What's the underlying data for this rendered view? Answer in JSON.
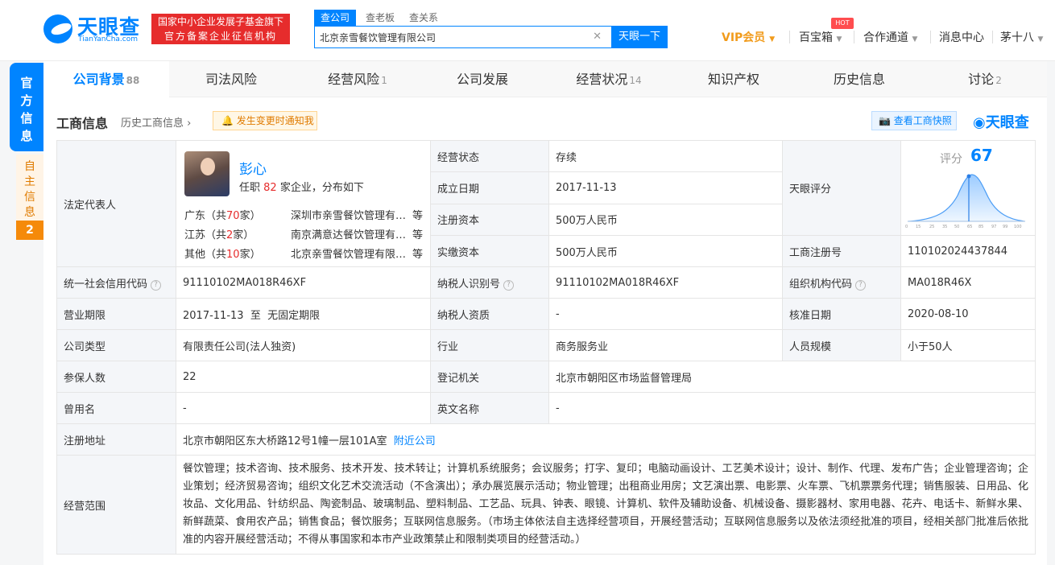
{
  "header": {
    "logo_name": "天眼查",
    "logo_domain": "TianYanCha.com",
    "promo_line1": "国家中小企业发展子基金旗下",
    "promo_line2": "官方备案企业征信机构",
    "search_tabs": [
      "查公司",
      "查老板",
      "查关系"
    ],
    "search_value": "北京亲雪餐饮管理有限公司",
    "search_button": "天眼一下",
    "nav": {
      "vip": "VIP会员",
      "treasure": "百宝箱",
      "hot_badge": "HOT",
      "partner": "合作通道",
      "messages": "消息中心",
      "user": "茅十八"
    }
  },
  "sidebar": {
    "official_tab": "官方信息",
    "self_tab": "自主信息",
    "self_count": "2"
  },
  "tabs": [
    {
      "label": "公司背景",
      "count": "88"
    },
    {
      "label": "司法风险",
      "count": ""
    },
    {
      "label": "经营风险",
      "count": "1"
    },
    {
      "label": "公司发展",
      "count": ""
    },
    {
      "label": "经营状况",
      "count": "14"
    },
    {
      "label": "知识产权",
      "count": ""
    },
    {
      "label": "历史信息",
      "count": ""
    },
    {
      "label": "讨论",
      "count": "2"
    }
  ],
  "section": {
    "title": "工商信息",
    "history_link": "历史工商信息",
    "alert_button": "发生变更时通知我",
    "snapshot_button": "查看工商快照",
    "brand": "天眼查"
  },
  "legal": {
    "label": "法定代表人",
    "name": "彭心",
    "desc_prefix": "任职",
    "desc_count": "82",
    "desc_suffix": "家企业，分布如下",
    "regions": [
      {
        "prefix": "广东（共",
        "count": "70",
        "suffix": "家）",
        "company": "深圳市亲雪餐饮管理有限公司",
        "etc": "等"
      },
      {
        "prefix": "江苏（共",
        "count": "2",
        "suffix": "家）",
        "company": "南京满意达餐饮管理有限公司",
        "etc": "等"
      },
      {
        "prefix": "其他（共",
        "count": "10",
        "suffix": "家）",
        "company": "北京亲雪餐饮管理有限公司",
        "etc": "等"
      }
    ]
  },
  "fields": {
    "status_label": "经营状态",
    "status": "存续",
    "score_label": "天眼评分",
    "score_word": "评分",
    "score": "67",
    "founded_label": "成立日期",
    "founded": "2017-11-13",
    "capital_label": "注册资本",
    "capital": "500万人民币",
    "paid_label": "实缴资本",
    "paid": "500万人民币",
    "regno_label": "工商注册号",
    "regno": "110102024437844",
    "credit_label": "统一社会信用代码",
    "credit": "91110102MA018R46XF",
    "taxid_label": "纳税人识别号",
    "taxid": "91110102MA018R46XF",
    "org_label": "组织机构代码",
    "org": "MA018R46X",
    "term_label": "营业期限",
    "term": "2017-11-13  至  无固定期限",
    "taxq_label": "纳税人资质",
    "taxq": "-",
    "approve_label": "核准日期",
    "approve": "2020-08-10",
    "type_label": "公司类型",
    "type": "有限责任公司(法人独资)",
    "industry_label": "行业",
    "industry": "商务服务业",
    "staff_label": "人员规模",
    "staff": "小于50人",
    "insured_label": "参保人数",
    "insured": "22",
    "authority_label": "登记机关",
    "authority": "北京市朝阳区市场监督管理局",
    "former_label": "曾用名",
    "former": "-",
    "english_label": "英文名称",
    "english": "-",
    "address_label": "注册地址",
    "address": "北京市朝阳区东大桥路12号1幢一层101A室",
    "nearby_link": "附近公司",
    "scope_label": "经营范围",
    "scope": "餐饮管理；技术咨询、技术服务、技术开发、技术转让；计算机系统服务；会议服务；打字、复印；电脑动画设计、工艺美术设计；设计、制作、代理、发布广告；企业管理咨询；企业策划；经济贸易咨询；组织文化艺术交流活动（不含演出）；承办展览展示活动；物业管理；出租商业用房；文艺演出票、电影票、火车票、飞机票票务代理；销售服装、日用品、化妆品、文化用品、针纺织品、陶瓷制品、玻璃制品、塑料制品、工艺品、玩具、钟表、眼镜、计算机、软件及辅助设备、机械设备、摄影器材、家用电器、花卉、电话卡、新鲜水果、新鲜蔬菜、食用农产品；销售食品；餐饮服务；互联网信息服务。（市场主体依法自主选择经营项目，开展经营活动；互联网信息服务以及依法须经批准的项目，经相关部门批准后依批准的内容开展经营活动；不得从事国家和本市产业政策禁止和限制类项目的经营活动。）"
  },
  "colors": {
    "brand": "#0084ff",
    "promo": "#e62c2c",
    "vip": "#f19b1b",
    "label_bg": "#f4f6f9"
  }
}
